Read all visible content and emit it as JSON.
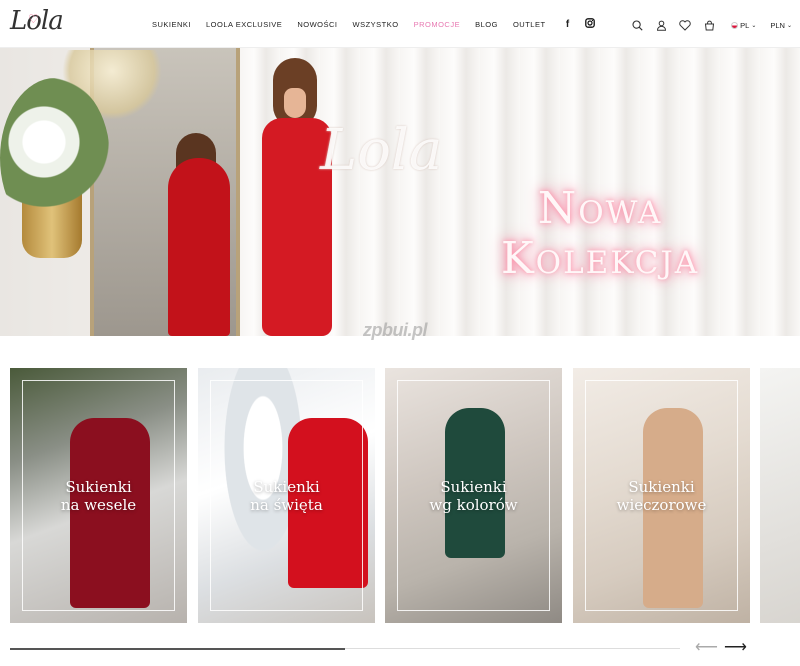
{
  "header": {
    "logo": "Lola",
    "nav": [
      "SUKIENKI",
      "LOOLA EXCLUSIVE",
      "NOWOŚCI",
      "WSZYSTKO",
      "PROMOCJE",
      "BLOG",
      "OUTLET"
    ],
    "social": [
      "facebook-icon",
      "instagram-icon"
    ],
    "icons": [
      "search-icon",
      "user-icon",
      "heart-icon",
      "bag-icon"
    ],
    "language": "PL",
    "currency": "PLN",
    "promo_color": "#e879b2"
  },
  "hero": {
    "logo": "Lola",
    "headline_line1": "Nowa",
    "headline_line2": "Kolekcja",
    "watermark": "zpbui.pl"
  },
  "categories": [
    {
      "line1": "Sukienki",
      "line2": "na wesele"
    },
    {
      "line1": "Sukienki",
      "line2": "na święta"
    },
    {
      "line1": "Sukienki",
      "line2": "wg kolorów"
    },
    {
      "line1": "Sukienki",
      "line2": "wieczorowe"
    }
  ],
  "carousel": {
    "progress": 0.5,
    "prev_icon": "arrow-left-icon",
    "next_icon": "arrow-right-icon"
  }
}
